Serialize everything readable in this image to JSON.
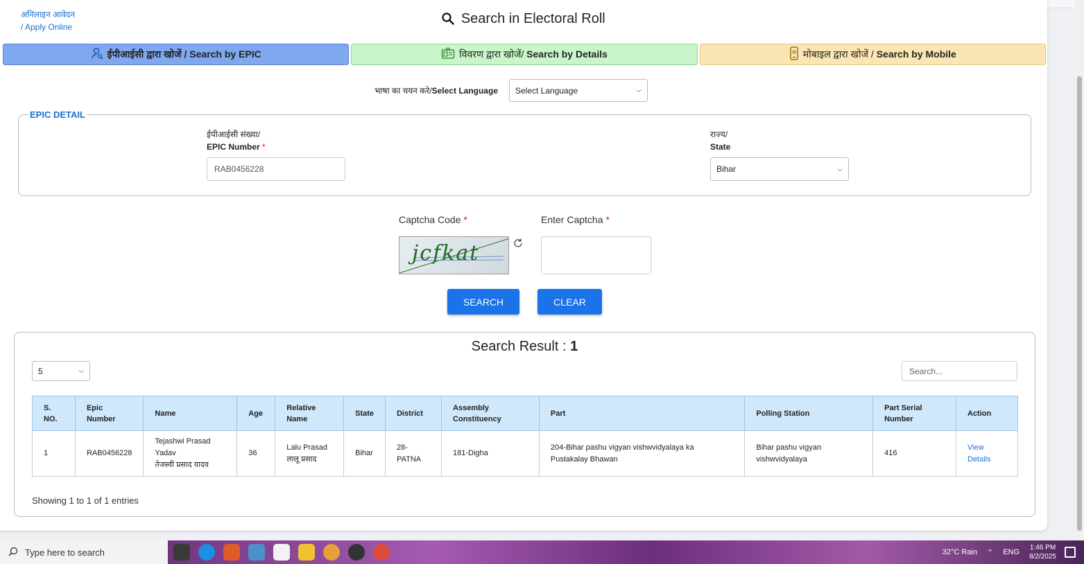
{
  "header": {
    "apply_online_hi": "अनिलाइन आवेदन",
    "apply_online_en": "/ Apply Online",
    "title": "Search in Electoral Roll"
  },
  "tabs": [
    {
      "label": "ईपीआईसी द्वारा खोजें / Search by EPIC",
      "icon": "user-icon"
    },
    {
      "label_hi": "विवरण द्वारा खोजें/",
      "label_en": "Search by Details",
      "icon": "id-card-icon"
    },
    {
      "label_hi": "मोबाइल द्वारा खोजें /",
      "label_en": "Search by Mobile",
      "icon": "mobile-icon"
    }
  ],
  "language": {
    "label_hi": "भाषा का चयन करे/",
    "label_en": "Select Language",
    "selected": "Select Language"
  },
  "epic_detail": {
    "legend": "EPIC DETAIL",
    "epic_label_hi": "ईपीआईसी संख्या/",
    "epic_label_en": "EPIC Number",
    "epic_value": "RAB0456228",
    "state_label_hi": "राज्य/",
    "state_label_en": "State",
    "state_value": "Bihar",
    "required_mark": "*"
  },
  "captcha": {
    "code_label": "Captcha Code",
    "enter_label": "Enter Captcha",
    "image_text": "jcfkat",
    "required_mark": "*"
  },
  "buttons": {
    "search": "SEARCH",
    "clear": "CLEAR"
  },
  "results": {
    "title_prefix": "Search Result : ",
    "count": "1",
    "page_size": "5",
    "search_placeholder": "Search...",
    "columns": [
      "S. NO.",
      "Epic Number",
      "Name",
      "Age",
      "Relative Name",
      "State",
      "District",
      "Assembly Constituency",
      "Part",
      "Polling Station",
      "Part Serial Number",
      "Action"
    ],
    "rows": [
      {
        "sno": "1",
        "epic": "RAB0456228",
        "name_en": "Tejashwi Prasad Yadav",
        "name_hi": "तेजस्वी प्रसाद यादव",
        "age": "36",
        "relative_en": "Lalu Prasad",
        "relative_hi": "लालू प्रसाद",
        "state": "Bihar",
        "district": "28-PATNA",
        "assembly": "181-Digha",
        "part": "204-Bihar pashu vigyan vishwvidyalaya ka Pustakalay Bhawan",
        "polling_station": "Bihar pashu vigyan vishwvidyalaya",
        "part_serial": "416",
        "action": "View Details"
      }
    ],
    "showing": "Showing 1 to 1 of 1 entries"
  },
  "taskbar": {
    "search_placeholder": "Type here to search",
    "weather": "32°C  Rain",
    "lang": "ENG",
    "time": "1:46 PM",
    "date": "8/2/2025"
  }
}
